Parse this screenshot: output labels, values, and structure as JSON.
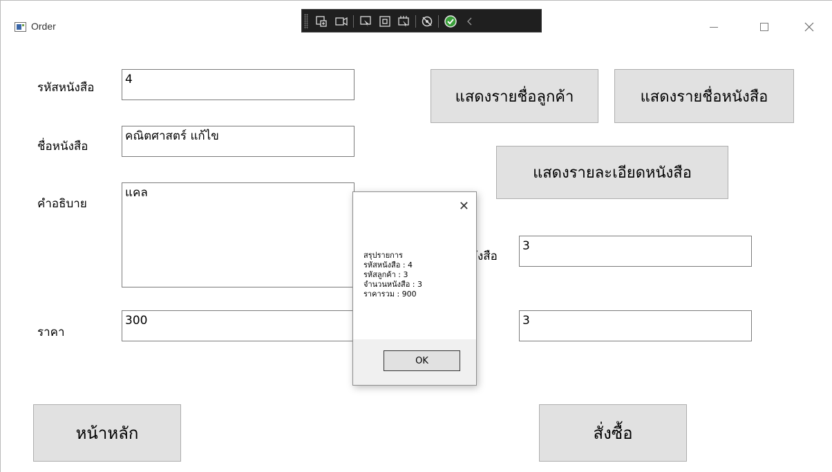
{
  "window": {
    "title": "Order",
    "accent": "#0078d7"
  },
  "debug_toolbar": {
    "icons": [
      "live-visual-tree-icon",
      "camera-icon",
      "select-element-icon",
      "display-adorners-icon",
      "track-focus-icon",
      "hot-reload-icon",
      "ok-status-icon",
      "collapse-chevron-icon"
    ]
  },
  "form": {
    "book_id_label": "รหัสหนังสือ",
    "book_id_value": "4",
    "book_name_label": "ชื่อหนังสือ",
    "book_name_value": "คณิตศาสตร์ แก้ไข",
    "description_label": "คำอธิบาย",
    "description_value": "แคล",
    "price_label": "ราคา",
    "price_value": "300",
    "quantity_label_partial": "ังสือ",
    "quantity_value": "3",
    "customer_value": "3"
  },
  "buttons": {
    "show_customers": "แสดงรายชื่อลูกค้า",
    "show_books": "แสดงรายชื่อหนังสือ",
    "show_book_details": "แสดงรายละเอียดหนังสือ",
    "home": "หน้าหลัก",
    "order": "สั่งซื้อ"
  },
  "dialog": {
    "close_symbol": "✕",
    "message": "สรุปรายการ\nรหัสหนังสือ : 4\nรหัสลูกค้า : 3\nจำนวนหนังสือ : 3\nราคารวม : 900",
    "ok_label": "OK"
  }
}
